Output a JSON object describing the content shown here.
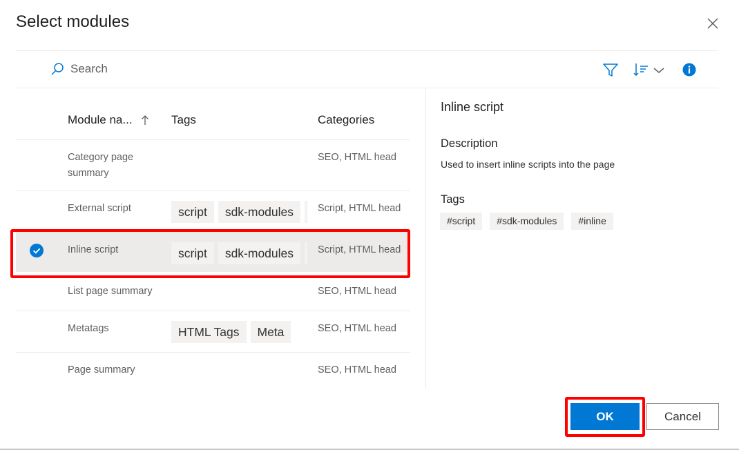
{
  "dialog": {
    "title": "Select modules"
  },
  "toolbar": {
    "search_placeholder": "Search"
  },
  "columns": {
    "name": "Module na...",
    "tags": "Tags",
    "categories": "Categories"
  },
  "rows": [
    {
      "name": "Category page summary",
      "tags": [],
      "categories": "SEO, HTML head",
      "selected": false
    },
    {
      "name": "External script",
      "tags": [
        "script",
        "sdk-modules"
      ],
      "categories": "Script, HTML head",
      "selected": false
    },
    {
      "name": "Inline script",
      "tags": [
        "script",
        "sdk-modules"
      ],
      "categories": "Script, HTML head",
      "selected": true
    },
    {
      "name": "List page summary",
      "tags": [],
      "categories": "SEO, HTML head",
      "selected": false
    },
    {
      "name": "Metatags",
      "tags": [
        "HTML Tags",
        "Meta"
      ],
      "categories": "SEO, HTML head",
      "selected": false
    },
    {
      "name": "Page summary",
      "tags": [],
      "categories": "SEO, HTML head",
      "selected": false
    }
  ],
  "detail": {
    "title": "Inline script",
    "description_heading": "Description",
    "description": "Used to insert inline scripts into the page",
    "tags_heading": "Tags",
    "tags": [
      "#script",
      "#sdk-modules",
      "#inline"
    ]
  },
  "footer": {
    "ok_label": "OK",
    "cancel_label": "Cancel"
  },
  "colors": {
    "primary": "#0078d4",
    "highlight": "#ff0000",
    "selected_row": "#edebe9"
  }
}
